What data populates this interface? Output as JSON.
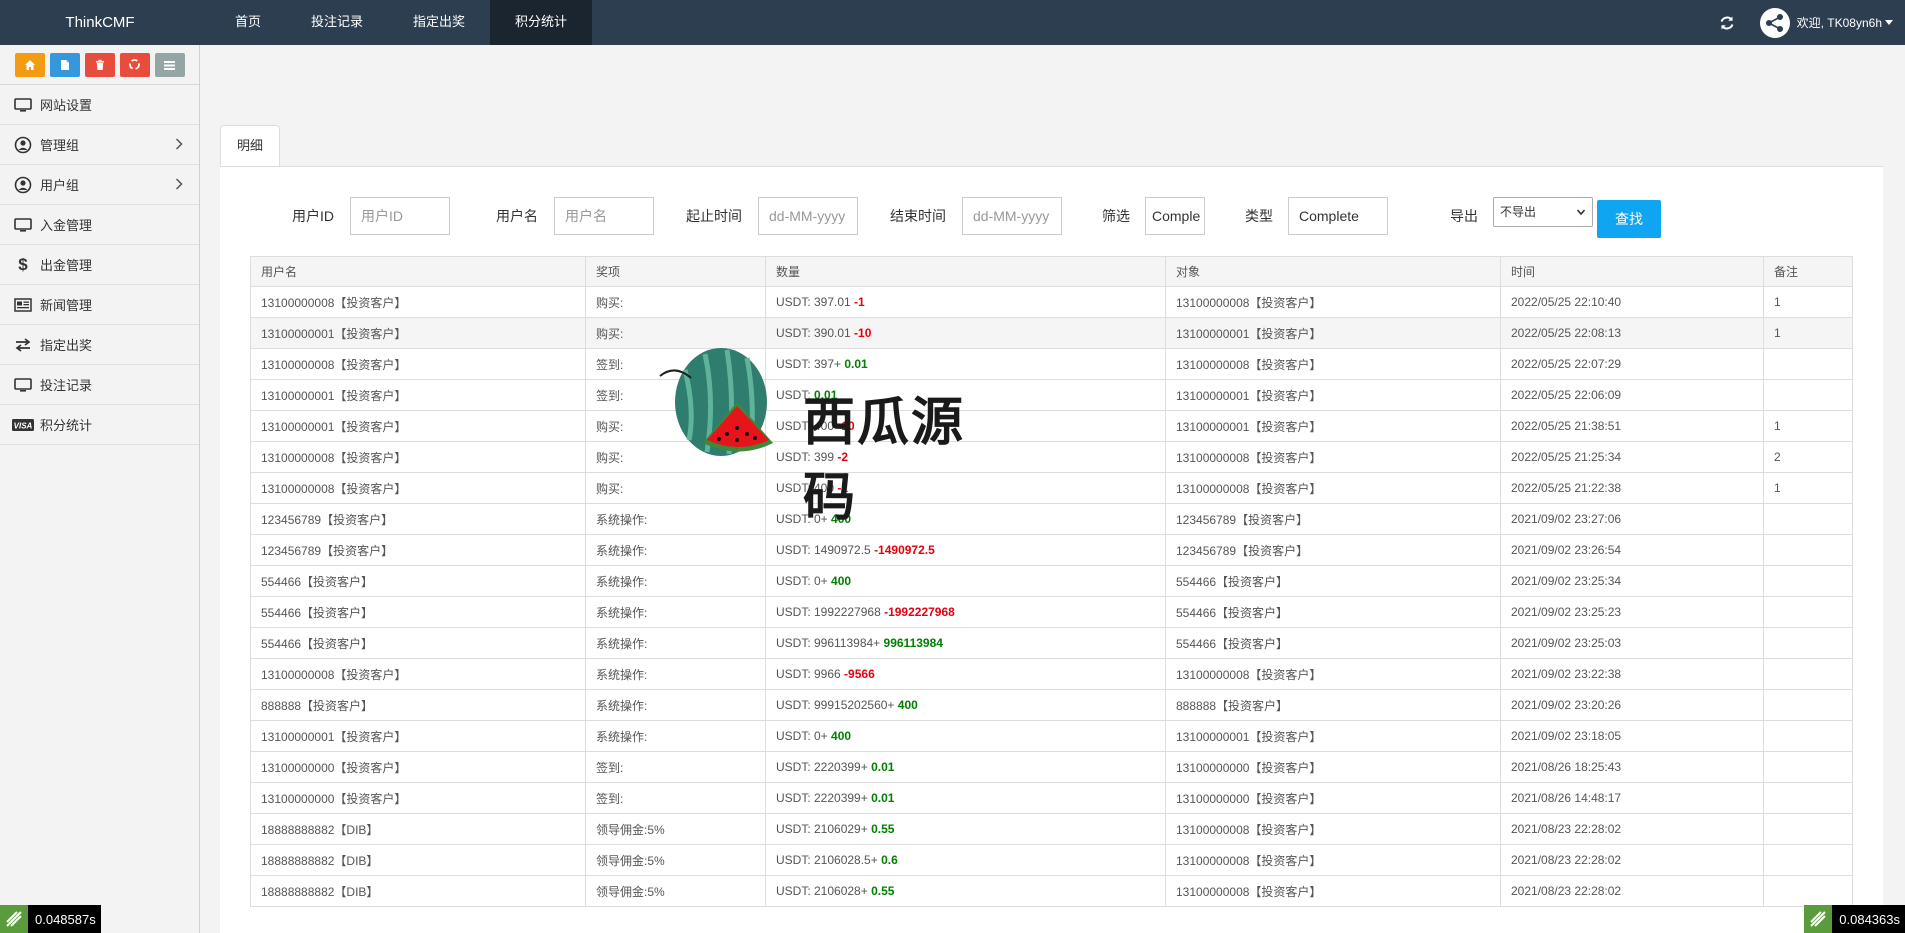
{
  "brand": "ThinkCMF",
  "nav": {
    "items": [
      "首页",
      "投注记录",
      "指定出奖",
      "积分统计"
    ],
    "active": "积分统计"
  },
  "user": {
    "greeting": "欢迎, TK08yn6h"
  },
  "shortcuts": [
    {
      "icon": "home-icon",
      "color": "#f39c12"
    },
    {
      "icon": "file-icon",
      "color": "#3498db"
    },
    {
      "icon": "trash-icon",
      "color": "#e74c3c"
    },
    {
      "icon": "recycle-icon",
      "color": "#e74c3c"
    },
    {
      "icon": "list-icon",
      "color": "#95a5a6"
    }
  ],
  "sidebar": {
    "items": [
      {
        "label": "网站设置",
        "icon": "monitor-icon",
        "has_submenu": false
      },
      {
        "label": "管理组",
        "icon": "user-circle-icon",
        "has_submenu": true
      },
      {
        "label": "用户组",
        "icon": "user-icon",
        "has_submenu": true
      },
      {
        "label": "入金管理",
        "icon": "monitor-icon",
        "has_submenu": false
      },
      {
        "label": "出金管理",
        "icon": "dollar-icon",
        "has_submenu": false
      },
      {
        "label": "新闻管理",
        "icon": "newspaper-icon",
        "has_submenu": false
      },
      {
        "label": "指定出奖",
        "icon": "exchange-icon",
        "has_submenu": false
      },
      {
        "label": "投注记录",
        "icon": "monitor-icon",
        "has_submenu": false
      },
      {
        "label": "积分统计",
        "icon": "visa-icon",
        "has_submenu": false
      }
    ]
  },
  "tab": {
    "label": "明细"
  },
  "filter": {
    "user_id": {
      "label": "用户ID",
      "placeholder": "用户ID",
      "value": ""
    },
    "username": {
      "label": "用户名",
      "placeholder": "用户名",
      "value": ""
    },
    "start_time": {
      "label": "起止时间",
      "placeholder": "dd-MM-yyyy",
      "value": ""
    },
    "end_time": {
      "label": "结束时间",
      "placeholder": "dd-MM-yyyy",
      "value": ""
    },
    "screen": {
      "label": "筛选",
      "value": "Comple"
    },
    "type": {
      "label": "类型",
      "value": "Complete"
    },
    "export": {
      "label": "导出",
      "selected": "不导出"
    },
    "search_button": "查找"
  },
  "table": {
    "columns": [
      "用户名",
      "奖项",
      "数量",
      "对象",
      "时间",
      "备注"
    ],
    "rows": [
      {
        "user": "13100000008【投资客户】",
        "award": "购买:",
        "amount_base": "USDT: 397.01 ",
        "delta": "-1",
        "delta_sign": "neg",
        "target": "13100000008【投资客户】",
        "time": "2022/05/25 22:10:40",
        "note": "1"
      },
      {
        "user": "13100000001【投资客户】",
        "award": "购买:",
        "amount_base": "USDT: 390.01 ",
        "delta": "-10",
        "delta_sign": "neg",
        "target": "13100000001【投资客户】",
        "time": "2022/05/25 22:08:13",
        "note": "1"
      },
      {
        "user": "13100000008【投资客户】",
        "award": "签到:",
        "amount_base": "USDT: 397+ ",
        "delta": "0.01",
        "delta_sign": "pos",
        "target": "13100000008【投资客户】",
        "time": "2022/05/25 22:07:29",
        "note": ""
      },
      {
        "user": "13100000001【投资客户】",
        "award": "签到:",
        "amount_base": "USDT: ",
        "delta": "0.01",
        "delta_sign": "pos",
        "target": "13100000001【投资客户】",
        "time": "2022/05/25 22:06:09",
        "note": ""
      },
      {
        "user": "13100000001【投资客户】",
        "award": "购买:",
        "amount_base": "USDT: 400 ",
        "delta": "-10",
        "delta_sign": "neg",
        "target": "13100000001【投资客户】",
        "time": "2022/05/25 21:38:51",
        "note": "1"
      },
      {
        "user": "13100000008【投资客户】",
        "award": "购买:",
        "amount_base": "USDT: 399 ",
        "delta": "-2",
        "delta_sign": "neg",
        "target": "13100000008【投资客户】",
        "time": "2022/05/25 21:25:34",
        "note": "2"
      },
      {
        "user": "13100000008【投资客户】",
        "award": "购买:",
        "amount_base": "USDT: 400 ",
        "delta": "-1",
        "delta_sign": "neg",
        "target": "13100000008【投资客户】",
        "time": "2022/05/25 21:22:38",
        "note": "1"
      },
      {
        "user": "123456789【投资客户】",
        "award": "系统操作:",
        "amount_base": "USDT: 0+ ",
        "delta": "400",
        "delta_sign": "pos",
        "target": "123456789【投资客户】",
        "time": "2021/09/02 23:27:06",
        "note": ""
      },
      {
        "user": "123456789【投资客户】",
        "award": "系统操作:",
        "amount_base": "USDT: 1490972.5 ",
        "delta": "-1490972.5",
        "delta_sign": "neg",
        "target": "123456789【投资客户】",
        "time": "2021/09/02 23:26:54",
        "note": ""
      },
      {
        "user": "554466【投资客户】",
        "award": "系统操作:",
        "amount_base": "USDT: 0+ ",
        "delta": "400",
        "delta_sign": "pos",
        "target": "554466【投资客户】",
        "time": "2021/09/02 23:25:34",
        "note": ""
      },
      {
        "user": "554466【投资客户】",
        "award": "系统操作:",
        "amount_base": "USDT: 1992227968 ",
        "delta": "-1992227968",
        "delta_sign": "neg",
        "target": "554466【投资客户】",
        "time": "2021/09/02 23:25:23",
        "note": ""
      },
      {
        "user": "554466【投资客户】",
        "award": "系统操作:",
        "amount_base": "USDT: 996113984+ ",
        "delta": "996113984",
        "delta_sign": "pos",
        "target": "554466【投资客户】",
        "time": "2021/09/02 23:25:03",
        "note": ""
      },
      {
        "user": "13100000008【投资客户】",
        "award": "系统操作:",
        "amount_base": "USDT: 9966 ",
        "delta": "-9566",
        "delta_sign": "neg",
        "target": "13100000008【投资客户】",
        "time": "2021/09/02 23:22:38",
        "note": ""
      },
      {
        "user": "888888【投资客户】",
        "award": "系统操作:",
        "amount_base": "USDT: 99915202560+ ",
        "delta": "400",
        "delta_sign": "pos",
        "target": "888888【投资客户】",
        "time": "2021/09/02 23:20:26",
        "note": ""
      },
      {
        "user": "13100000001【投资客户】",
        "award": "系统操作:",
        "amount_base": "USDT: 0+ ",
        "delta": "400",
        "delta_sign": "pos",
        "target": "13100000001【投资客户】",
        "time": "2021/09/02 23:18:05",
        "note": ""
      },
      {
        "user": "13100000000【投资客户】",
        "award": "签到:",
        "amount_base": "USDT: 2220399+ ",
        "delta": "0.01",
        "delta_sign": "pos",
        "target": "13100000000【投资客户】",
        "time": "2021/08/26 18:25:43",
        "note": ""
      },
      {
        "user": "13100000000【投资客户】",
        "award": "签到:",
        "amount_base": "USDT: 2220399+ ",
        "delta": "0.01",
        "delta_sign": "pos",
        "target": "13100000000【投资客户】",
        "time": "2021/08/26 14:48:17",
        "note": ""
      },
      {
        "user": "18888888882【DIB】",
        "award": "领导佣金:5%",
        "amount_base": "USDT: 2106029+ ",
        "delta": "0.55",
        "delta_sign": "pos",
        "target": "13100000008【投资客户】",
        "time": "2021/08/23 22:28:02",
        "note": ""
      },
      {
        "user": "18888888882【DIB】",
        "award": "领导佣金:5%",
        "amount_base": "USDT: 2106028.5+ ",
        "delta": "0.6",
        "delta_sign": "pos",
        "target": "13100000008【投资客户】",
        "time": "2021/08/23 22:28:02",
        "note": ""
      },
      {
        "user": "18888888882【DIB】",
        "award": "领导佣金:5%",
        "amount_base": "USDT: 2106028+ ",
        "delta": "0.55",
        "delta_sign": "pos",
        "target": "13100000008【投资客户】",
        "time": "2021/08/23 22:28:02",
        "note": ""
      }
    ]
  },
  "watermark": {
    "text": "西瓜源码"
  },
  "timers": {
    "left": "0.048587s",
    "right": "0.084363s"
  },
  "colors": {
    "navbar": "#2c3e50",
    "search_button": "#10a5f0",
    "negative": "#e50011",
    "positive": "#008000"
  }
}
